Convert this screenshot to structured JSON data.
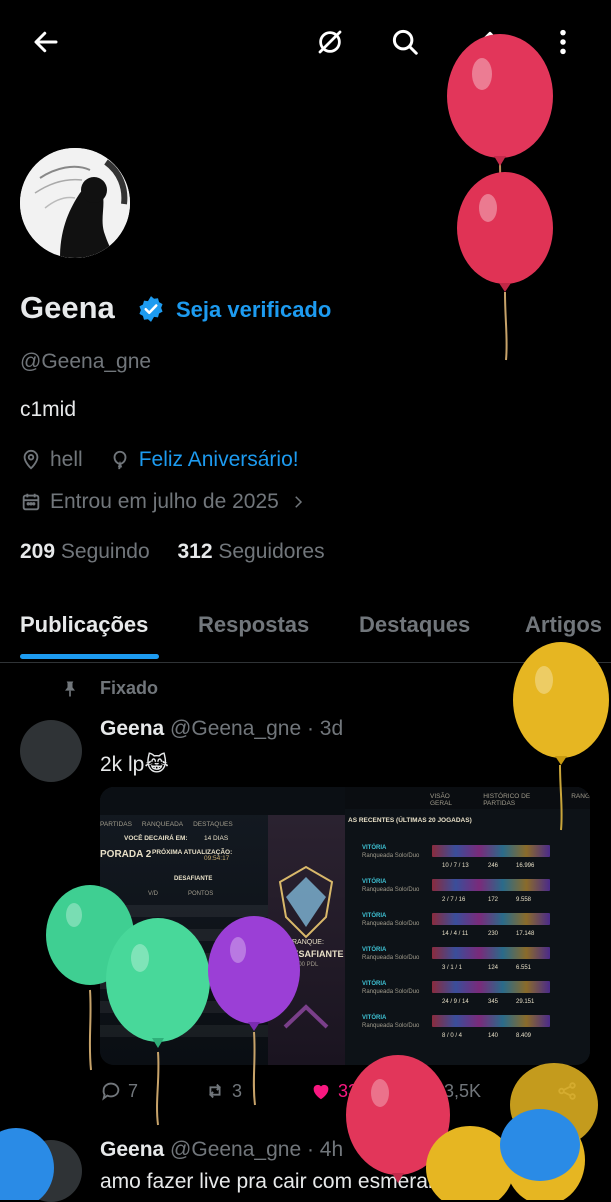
{
  "profile": {
    "name": "Geena",
    "verify_cta": "Seja verificado",
    "handle": "@Geena_gne",
    "bio": "c1mid",
    "location": "hell",
    "birthday": "Feliz Aniversário!",
    "joined": "Entrou em julho de 2025",
    "following_count": "209",
    "following_label": "Seguindo",
    "followers_count": "312",
    "followers_label": "Seguidores"
  },
  "tabs": [
    {
      "label": "Publicações",
      "active": true
    },
    {
      "label": "Respostas"
    },
    {
      "label": "Destaques"
    },
    {
      "label": "Artigos"
    }
  ],
  "pinned_label": "Fixado",
  "posts": [
    {
      "author": "Geena",
      "handle": "@Geena_gne",
      "time": "· 3d",
      "text": "2k lp😹",
      "replies": "7",
      "reposts": "3",
      "likes": "33",
      "views": "3,5K"
    },
    {
      "author": "Geena",
      "handle": "@Geena_gne",
      "time": "· 4h",
      "text": "amo fazer live pra cair com esmeralda"
    }
  ],
  "media": {
    "left_tabs": [
      "PARTIDAS",
      "RANQUEADA",
      "DESTAQUES"
    ],
    "season": "PORADA 2",
    "drop_label": "VOCÊ DECAIRÁ EM:",
    "drop_value": "14 DIAS",
    "next_update": "PRÓXIMA ATUALIZAÇÃO:",
    "next_update_value": "09:54:17",
    "col_headers": [
      "V/D",
      "PONTOS"
    ],
    "rank_name": "DESAFIANTE",
    "rank_label": "RANQUE:",
    "rank_sub": "2.000 PDL",
    "right_tabs": [
      "VISÃO GERAL",
      "HISTÓRICO DE PARTIDAS",
      "RANG"
    ],
    "history_title": "AS RECENTES (ÚLTIMAS 20 JOGADAS)",
    "matches": [
      {
        "result": "VITÓRIA",
        "queue": "Ranqueada Solo/Duo",
        "kda": "10 / 7 / 13",
        "cs": "246",
        "gold": "16.996"
      },
      {
        "result": "VITÓRIA",
        "queue": "Ranqueada Solo/Duo",
        "kda": "2 / 7 / 16",
        "cs": "172",
        "gold": "9.558"
      },
      {
        "result": "VITÓRIA",
        "queue": "Ranqueada Solo/Duo",
        "kda": "14 / 4 / 11",
        "cs": "230",
        "gold": "17.148"
      },
      {
        "result": "VITÓRIA",
        "queue": "Ranqueada Solo/Duo",
        "kda": "3 / 1 / 1",
        "cs": "124",
        "gold": "6.551"
      },
      {
        "result": "VITÓRIA",
        "queue": "Ranqueada Solo/Duo",
        "kda": "24 / 9 / 14",
        "cs": "345",
        "gold": "29.151"
      },
      {
        "result": "VITÓRIA",
        "queue": "Ranqueada Solo/Duo",
        "kda": "8 / 0 / 4",
        "cs": "140",
        "gold": "8.409"
      }
    ]
  },
  "icons": {
    "back": "arrow-left-icon",
    "no_notify": "bell-off-icon",
    "search": "search-icon",
    "edit": "edit-icon",
    "more": "more-vertical-icon"
  },
  "colors": {
    "accent": "#1d9bf0",
    "like": "#f91880",
    "muted": "#71767b"
  }
}
